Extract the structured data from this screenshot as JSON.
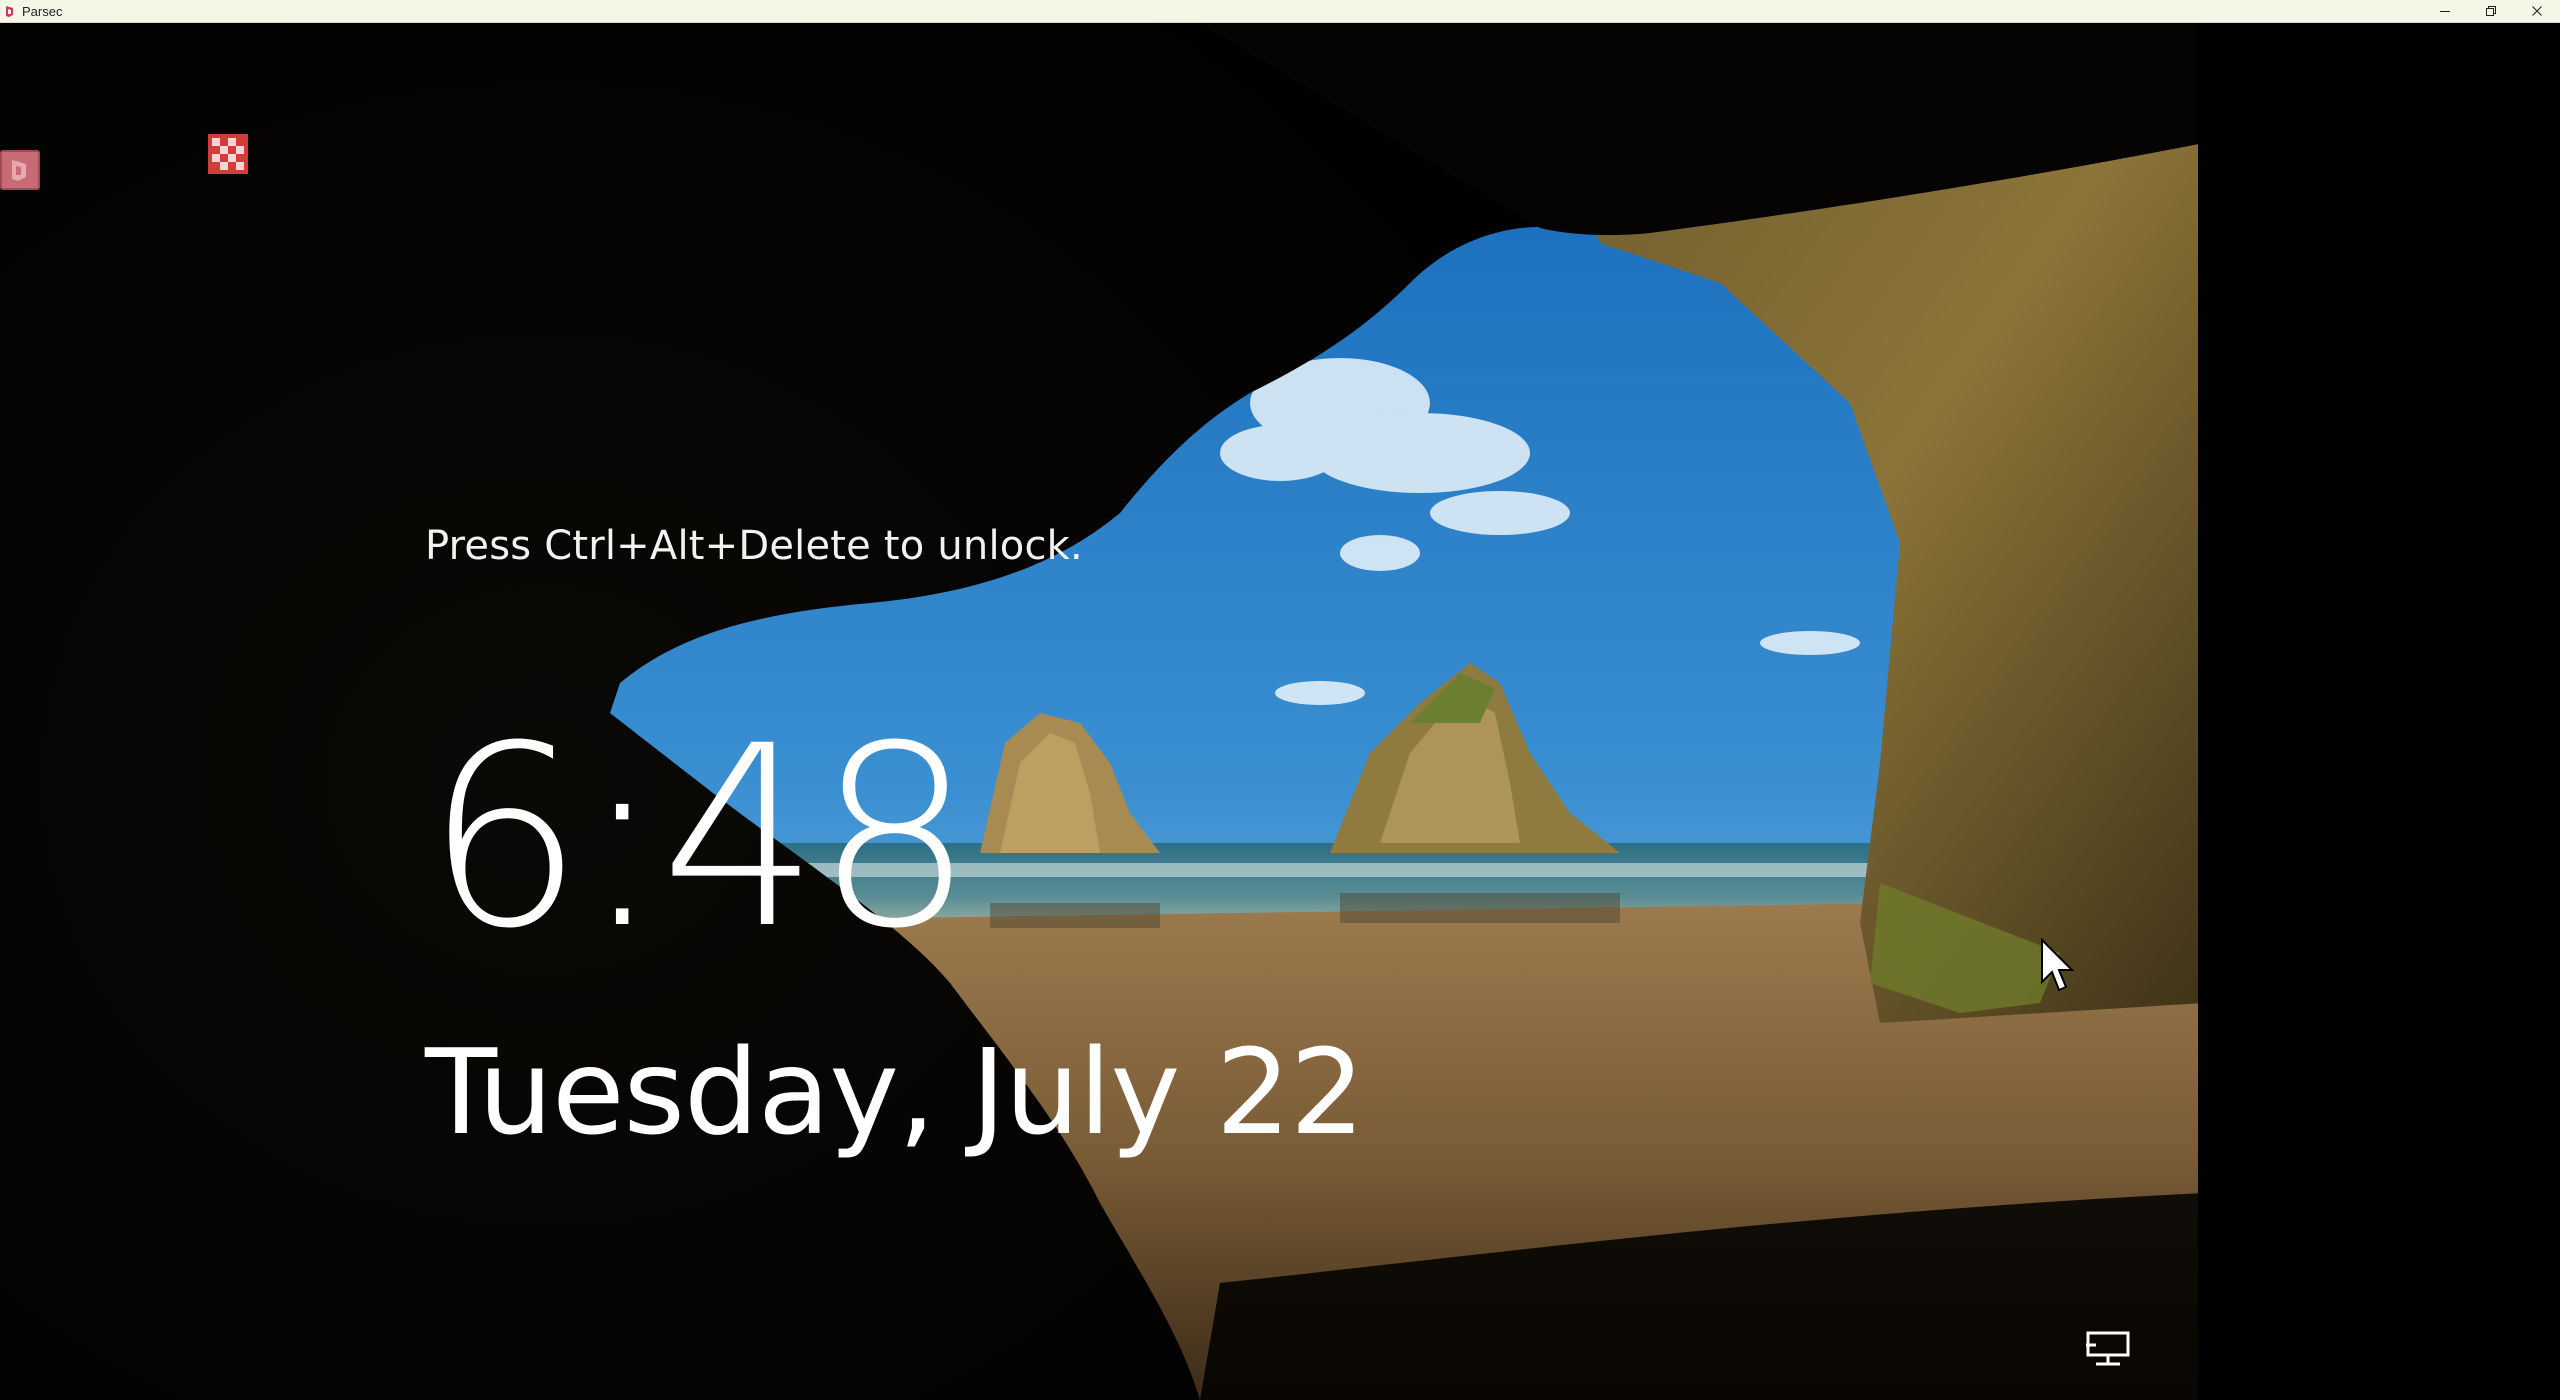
{
  "window": {
    "title": "Parsec",
    "controls": {
      "minimize_icon": "minimize-icon",
      "maximize_icon": "restore-icon",
      "close_icon": "close-icon"
    }
  },
  "lockscreen": {
    "unlock_hint": "Press Ctrl+Alt+Delete to unlock.",
    "time": "6:48",
    "date": "Tuesday, July 22",
    "network_icon": "network-icon"
  },
  "overlay": {
    "parsec_button_icon": "parsec-logo-icon",
    "stream_status_icon": "checker-icon"
  },
  "colors": {
    "titlebar_bg": "#f4f7e6",
    "parsec_brand": "#d0346b",
    "overlay_button": "#c96b77"
  }
}
